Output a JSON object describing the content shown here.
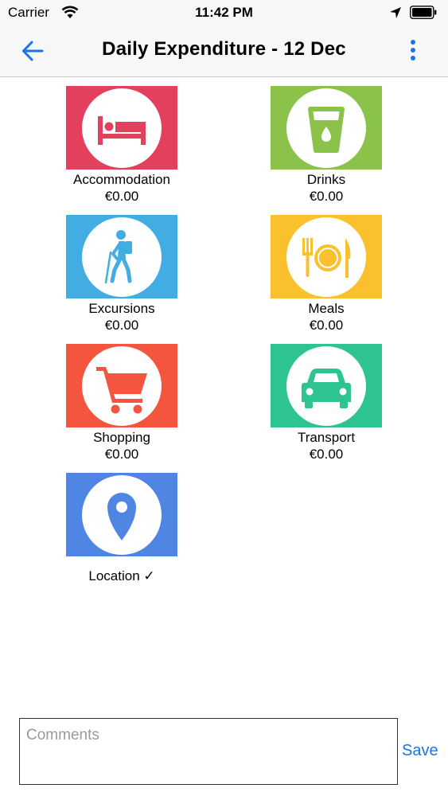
{
  "status_bar": {
    "carrier": "Carrier",
    "time": "11:42 PM"
  },
  "nav": {
    "title": "Daily Expenditure - 12 Dec",
    "back_icon": "arrow-left-icon",
    "menu_icon": "more-vertical-icon",
    "accent": "#1a73e8"
  },
  "categories": [
    {
      "label": "Accommodation",
      "amount": "€0.00",
      "color": "#e2405c",
      "icon": "bed-icon"
    },
    {
      "label": "Drinks",
      "amount": "€0.00",
      "color": "#8bc34a",
      "icon": "glass-icon"
    },
    {
      "label": "Excursions",
      "amount": "€0.00",
      "color": "#42ade2",
      "icon": "hiker-icon"
    },
    {
      "label": "Meals",
      "amount": "€0.00",
      "color": "#fbc02d",
      "icon": "cutlery-icon"
    },
    {
      "label": "Shopping",
      "amount": "€0.00",
      "color": "#f4553f",
      "icon": "cart-icon"
    },
    {
      "label": "Transport",
      "amount": "€0.00",
      "color": "#2ec48f",
      "icon": "car-icon"
    },
    {
      "label": "Location ✓",
      "color": "#4f86e4",
      "icon": "map-pin-icon"
    }
  ],
  "comments": {
    "placeholder": "Comments"
  },
  "save_label": "Save"
}
